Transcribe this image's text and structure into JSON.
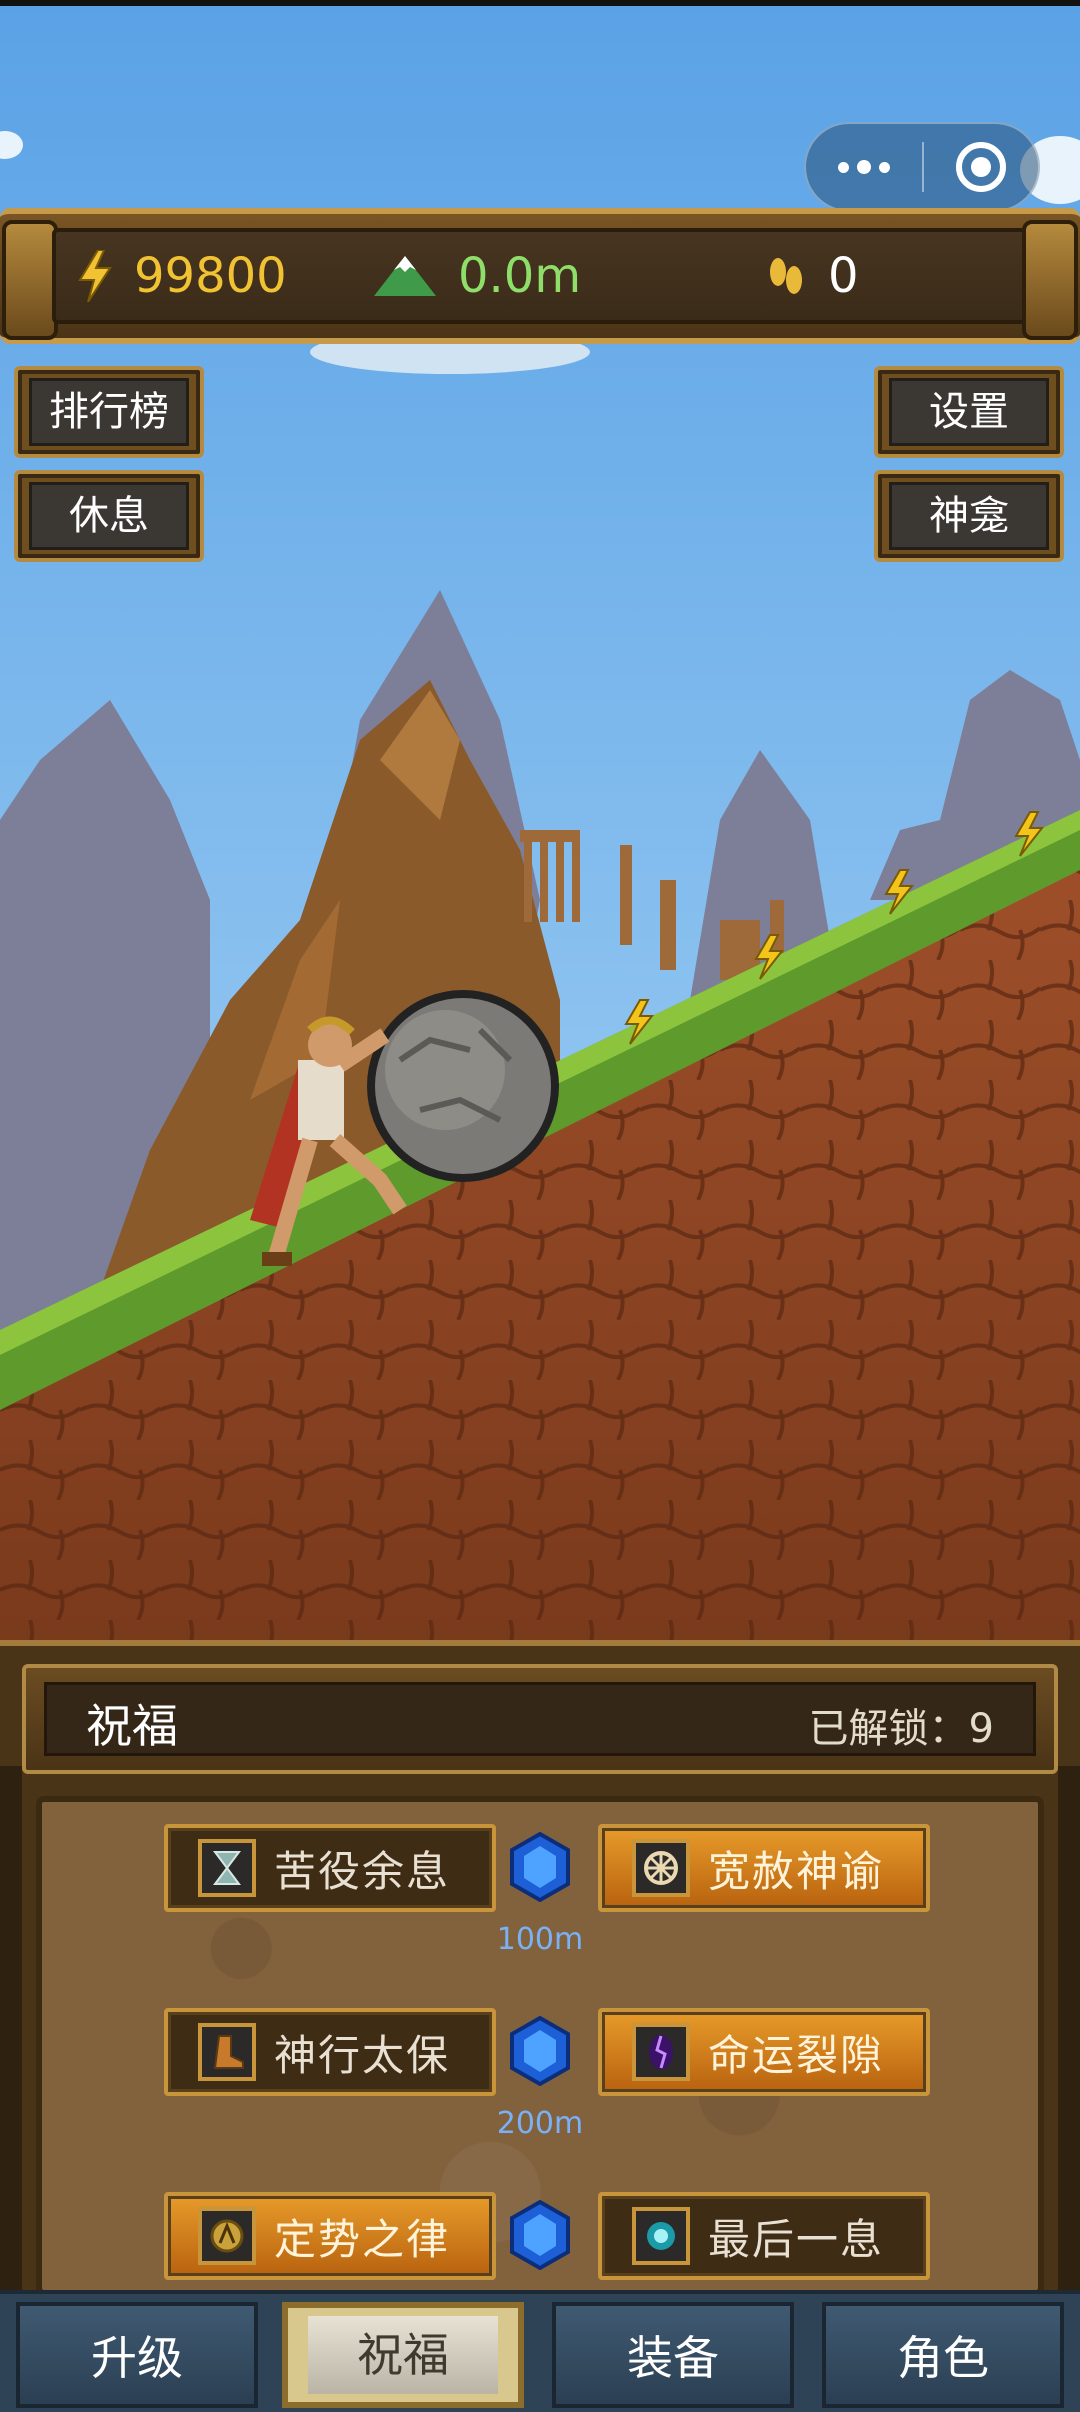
{
  "top_bar": {
    "energy": "99800",
    "height": "0.0m",
    "steps": "0"
  },
  "side_buttons": {
    "leaderboard": "排行榜",
    "rest": "休息",
    "settings": "设置",
    "shrine": "神龛"
  },
  "panel": {
    "title": "祝福",
    "unlocked": "已解锁：9",
    "rows": [
      {
        "left": {
          "label": "苦役余息",
          "icon": "hourglass-icon",
          "active": false
        },
        "right": {
          "label": "宽赦神谕",
          "icon": "wheel-icon",
          "active": true
        },
        "distance": "100m"
      },
      {
        "left": {
          "label": "神行太保",
          "icon": "boot-icon",
          "active": false
        },
        "right": {
          "label": "命运裂隙",
          "icon": "rift-icon",
          "active": true
        },
        "distance": "200m"
      },
      {
        "left": {
          "label": "定势之律",
          "icon": "compass-icon",
          "active": true
        },
        "right": {
          "label": "最后一息",
          "icon": "spirit-icon",
          "active": false
        },
        "distance": ""
      }
    ]
  },
  "nav": {
    "tabs": [
      {
        "label": "升级",
        "active": false
      },
      {
        "label": "祝福",
        "active": true
      },
      {
        "label": "装备",
        "active": false
      },
      {
        "label": "角色",
        "active": false
      }
    ]
  },
  "colors": {
    "sky": "#63a8e6",
    "energy": "#f1c232",
    "height": "#8fde6a",
    "distance": "#7ab0f5",
    "active_bless": "#e79b2a"
  }
}
